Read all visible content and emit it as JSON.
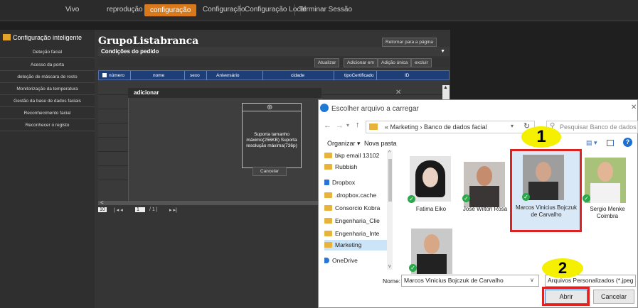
{
  "topnav": [
    "Vivo",
    "reprodução",
    "configuração",
    "Configuração",
    "Configuração Local",
    "Terminar Sessão"
  ],
  "sidebar": {
    "title": "Configuração inteligente",
    "items": [
      "Deteção facial",
      "Acesso da porta",
      "deteção de máscara de rosto",
      "Monitorização da temperatura",
      "Gestão da base de dados faciais",
      "Reconhecimento facial",
      "Reconhecer o registo"
    ]
  },
  "main": {
    "title": "GrupoListabranca",
    "return_btn": "Retornar para a página",
    "conditions": "Condições do pedido",
    "toolbar": [
      "Atualizar",
      "Adicionar em",
      "Adição única",
      "excluir"
    ],
    "columns": [
      "número",
      "nome",
      "sexo",
      "Aniversário",
      "cidade",
      "tipoCertificado",
      "ID"
    ],
    "pager": {
      "rows": "10",
      "page": "1",
      "total": "/ 1 |"
    }
  },
  "add_dialog": {
    "title": "adicionar",
    "upload_text": "Suporta tamanho máximo(256KB) Suporta resolução máxima(736p)",
    "cancel": "Cancelar",
    "plus": "⊕"
  },
  "file_dialog": {
    "title": "Escolher arquivo a carregar",
    "address": "« Marketing › Banco de dados facial",
    "search_placeholder": "Pesquisar Banco de dados fa...",
    "organize": "Organizar ▾",
    "new_folder": "Nova pasta",
    "tree": [
      "bkp email 13102",
      "Rubbish",
      "Dropbox",
      ".dropbox.cache",
      "Consorcio Kobra",
      "Engenharia_Clie",
      "Engenharia_Inte",
      "Marketing",
      "OneDrive"
    ],
    "files": [
      {
        "name": "Fatima Eiko"
      },
      {
        "name": "José Wilton Rosa"
      },
      {
        "name": "Marcos Vinicius Bojczuk de Carvalho"
      },
      {
        "name": "Sergio Menke Coimbra"
      },
      {
        "name": ""
      }
    ],
    "filename_label": "Nome:",
    "filename": "Marcos Vinicius Bojczuk de Carvalho",
    "filetype": "Arquivos Personalizados (*.jpeg",
    "open": "Abrir",
    "cancel": "Cancelar"
  },
  "annotations": {
    "step1": "1",
    "step2": "2",
    "color_highlight": "#d22222",
    "color_marker": "#f4f000"
  }
}
